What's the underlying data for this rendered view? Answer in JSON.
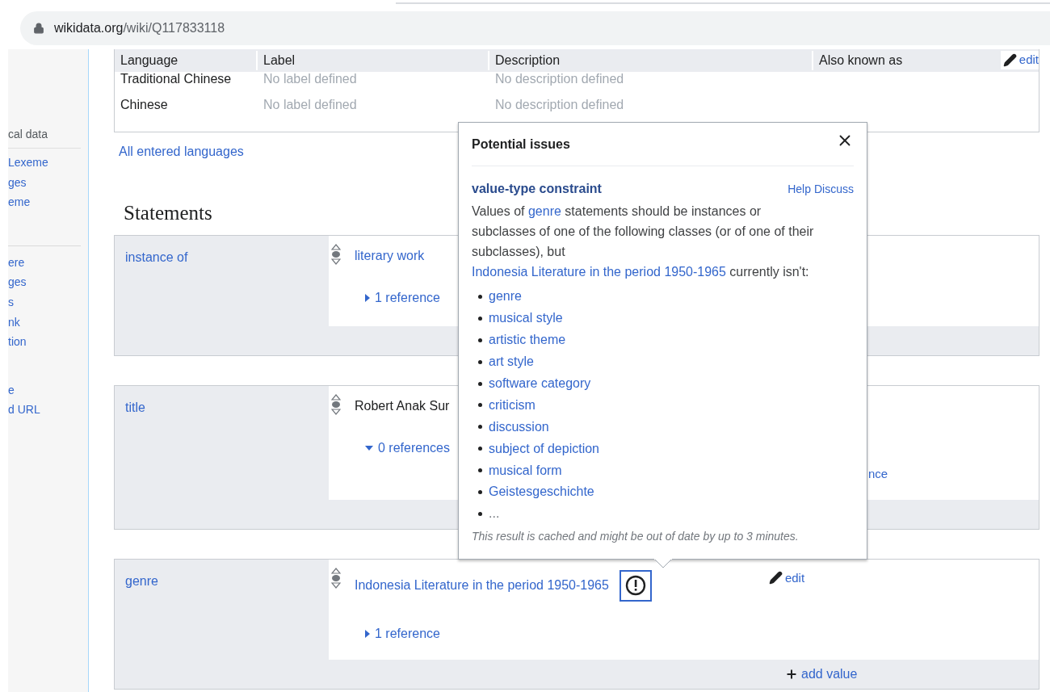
{
  "browser": {
    "url_host": "wikidata.org",
    "url_path": "/wiki/Q117833118"
  },
  "sidebar": {
    "groups": [
      {
        "heading": "cal data",
        "items": [
          "Lexeme",
          "ges",
          "eme"
        ]
      },
      {
        "items": [
          "ere",
          "ges",
          "s",
          "nk",
          "tion"
        ]
      },
      {
        "items": [
          "e",
          "d URL"
        ]
      }
    ]
  },
  "terms": {
    "columns": [
      "Language",
      "Label",
      "Description",
      "Also known as"
    ],
    "edit": "edit",
    "rows": [
      {
        "language": "Traditional Chinese",
        "label": "No label defined",
        "description": "No description defined"
      },
      {
        "language": "Chinese",
        "label": "No label defined",
        "description": "No description defined"
      }
    ],
    "all_languages": "All entered languages"
  },
  "statements_heading": "Statements",
  "statements": [
    {
      "property": "instance of",
      "value": "literary work",
      "value_is_link": true,
      "references": "1 reference",
      "references_expanded": false
    },
    {
      "property": "title",
      "value": "Robert Anak Sur",
      "value_is_link": false,
      "references": "0 references",
      "references_expanded": true,
      "add_reference": "nce"
    },
    {
      "property": "genre",
      "value": "Indonesia Literature in the period 1950-1965",
      "value_is_link": true,
      "references": "1 reference",
      "references_expanded": false,
      "warning": true,
      "edit": "edit",
      "add_value": "add value"
    }
  ],
  "popup": {
    "title": "Potential issues",
    "constraint": "value-type constraint",
    "help": "Help",
    "discuss": "Discuss",
    "message": [
      {
        "text": "Values of ",
        "link": false
      },
      {
        "text": "genre",
        "link": true
      },
      {
        "text": " statements should be instances or subclasses of one of the following classes (or of one of their subclasses), but ",
        "link": false
      },
      {
        "text": "Indonesia Literature in the period ",
        "link": true
      },
      {
        "text": "1950-1965",
        "link": true
      },
      {
        "text": " currently isn't:",
        "link": false
      }
    ],
    "classes": [
      {
        "text": "genre",
        "link": true
      },
      {
        "text": "musical style",
        "link": true
      },
      {
        "text": "artistic theme",
        "link": true
      },
      {
        "text": "art style",
        "link": true
      },
      {
        "text": "software category",
        "link": true
      },
      {
        "text": "criticism",
        "link": true
      },
      {
        "text": "discussion",
        "link": true
      },
      {
        "text": "subject of depiction",
        "link": true
      },
      {
        "text": "musical form",
        "link": true
      },
      {
        "text": "Geistesgeschichte",
        "link": true
      },
      {
        "text": "...",
        "link": false
      }
    ],
    "note": "This result is cached and might be out of date by up to 3 minutes."
  }
}
